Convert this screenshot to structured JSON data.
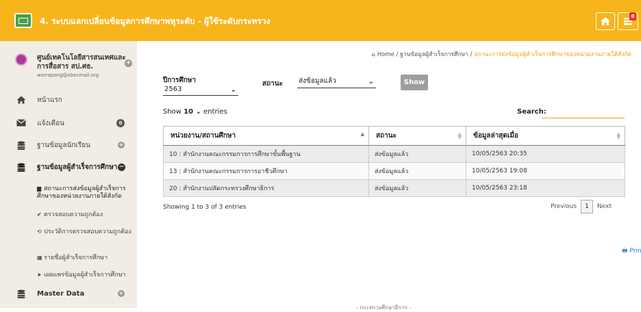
{
  "header": {
    "title": "4. ระบบแลกเปลี่ยนข้อมูลการศึกษาพหุระดับ - ผู้ใช้ระดับกระทรวง",
    "notification_count": "0",
    "brand_color": "#f7b51b"
  },
  "sidebar": {
    "org_name": "ศูนย์เทคโนโลยีสารสนเทศและการสื่อสาร สป.ศธ.",
    "org_email": "worrapong@obecmail.org",
    "items": [
      {
        "label": "หน้าแรก",
        "icon": "home-icon"
      },
      {
        "label": "แจ้งเตือน",
        "icon": "envelope-icon",
        "badge": "0"
      },
      {
        "label": "ฐานข้อมูลนักเรียน",
        "icon": "database-icon"
      },
      {
        "label": "ฐานข้อมูลผู้สำเร็จการศึกษา",
        "icon": "database-icon"
      },
      {
        "label": "Master Data",
        "icon": "database-icon"
      }
    ],
    "subitems": [
      {
        "label": "สถานะการส่งข้อมูลผู้สำเร็จการศึกษาของหน่วยงานภายใต้สังกัด",
        "icon": "table-icon"
      },
      {
        "label": "ตรวจสอบความถูกต้อง",
        "icon": "check-icon"
      },
      {
        "label": "ประวัติการตรวจสอบความถูกต้อง",
        "icon": "history-icon"
      },
      {
        "label": "รายชื่อผู้สำเร็จการศึกษา",
        "icon": "list-icon"
      },
      {
        "label": "เผยแพร่ข้อมูลผู้สำเร็จการศึกษา",
        "icon": "send-icon"
      }
    ]
  },
  "breadcrumb": {
    "home": "Home",
    "level1": "ฐานข้อมูลผู้สำเร็จการศึกษา",
    "current": "สถานะการส่งข้อมูลผู้สำเร็จการศึกษาของหน่วยงานภายใต้สังกัด"
  },
  "filters": {
    "year_label": "ปีการศึกษา",
    "year_value": "2563",
    "status_label": "สถานะ",
    "status_value": "ส่งข้อมูลแล้ว",
    "show_button": "Show"
  },
  "table_controls": {
    "show_prefix": "Show",
    "page_size": "10",
    "show_suffix": "entries",
    "search_label": "Search:"
  },
  "table": {
    "columns": [
      "หน่วยงาน/สถานศึกษา",
      "สถานะ",
      "ข้อมูลล่าสุดเมื่อ"
    ],
    "rows": [
      {
        "org": "10 : สำนักงานคณะกรรมการการศึกษาขั้นพื้นฐาน",
        "status": "ส่งข้อมูลแล้ว",
        "updated": "10/05/2563 20:35"
      },
      {
        "org": "13 : สำนักงานคณะกรรมการการอาชีวศึกษา",
        "status": "ส่งข้อมูลแล้ว",
        "updated": "10/05/2563 19:08"
      },
      {
        "org": "20 : สำนักงานปลัดกระทรวงศึกษาธิการ",
        "status": "ส่งข้อมูลแล้ว",
        "updated": "10/05/2563 23:18"
      }
    ],
    "info": "Showing 1 to 3 of 3 entries",
    "pager": {
      "previous": "Previous",
      "page": "1",
      "next": "Next"
    }
  },
  "print_label": "Print",
  "footer": "- กระทรวงศึกษาธิการ -"
}
